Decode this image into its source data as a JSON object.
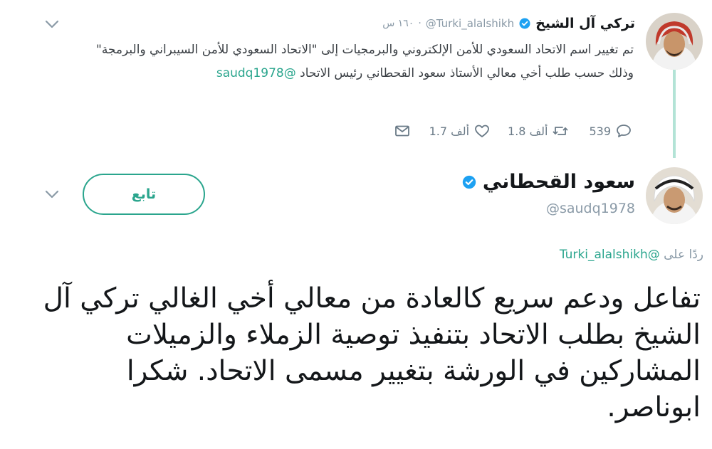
{
  "parent_tweet": {
    "name": "تركي آل الشيخ",
    "handle": "@Turki_alalshikh",
    "time": "١٦٠ س",
    "text": "تم تغيير اسم الاتحاد السعودي للأمن الإلكتروني والبرمجيات إلى \"الاتحاد السعودي للأمن السيبراني والبرمجة\" وذلك حسب طلب أخي معالي الأستاذ سعود القحطاني رئيس الاتحاد",
    "mention": "@saudq1978",
    "replies": "539",
    "retweets": "1.8 ألف",
    "likes": "1.7 ألف"
  },
  "main_tweet": {
    "name": "سعود القحطاني",
    "handle": "@saudq1978",
    "follow_label": "تابع",
    "reply_prefix": "ردًا على",
    "reply_to": "@Turki_alalshikh",
    "text": "تفاعل ودعم سريع كالعادة من معالي أخي الغالي تركي آل الشيخ بطلب الاتحاد بتنفيذ توصية الزملاء والزميلات المشاركين في الورشة بتغيير مسمى الاتحاد.  شكرا ابوناصر."
  },
  "colors": {
    "accent": "#2aa58d",
    "verified": "#1da1f2",
    "muted": "#8a9aa7",
    "thread_line": "#b3e3d6"
  },
  "icons": [
    "chevron-down-icon",
    "verified-icon",
    "reply-icon",
    "retweet-icon",
    "like-icon",
    "message-icon"
  ]
}
